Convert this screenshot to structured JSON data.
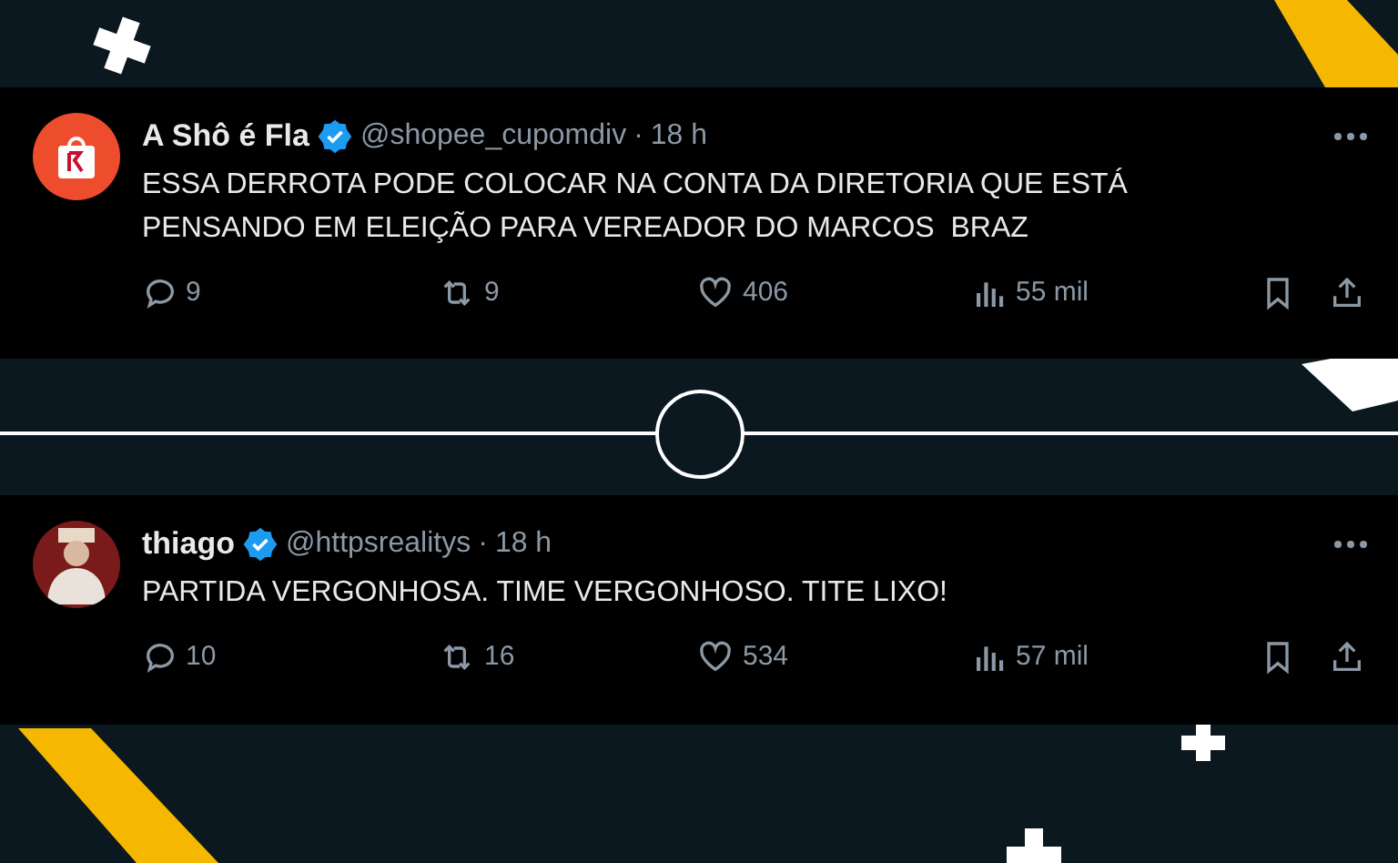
{
  "tweets": [
    {
      "name": "A Shô é Fla",
      "verified": true,
      "handle": "@shopee_cupomdiv",
      "separator": "·",
      "time": "18 h",
      "kind": "shop-bag",
      "lines": [
        "ESSA DERROTA PODE COLOCAR NA CONTA DA DIRETORIA QUE ESTÁ",
        "PENSANDO EM ELEIÇÃO PARA VEREADOR DO MARCOS  BRAZ"
      ],
      "replies": "9",
      "reposts": "9",
      "likes": "406",
      "views": "55 mil"
    },
    {
      "name": "thiago",
      "verified": true,
      "handle": "@httpsrealitys",
      "separator": "·",
      "time": "18 h",
      "kind": "person",
      "lines": [
        "PARTIDA VERGONHOSA. TIME VERGONHOSO. TITE LIXO!"
      ],
      "replies": "10",
      "reposts": "16",
      "likes": "534",
      "views": "57 mil"
    }
  ]
}
